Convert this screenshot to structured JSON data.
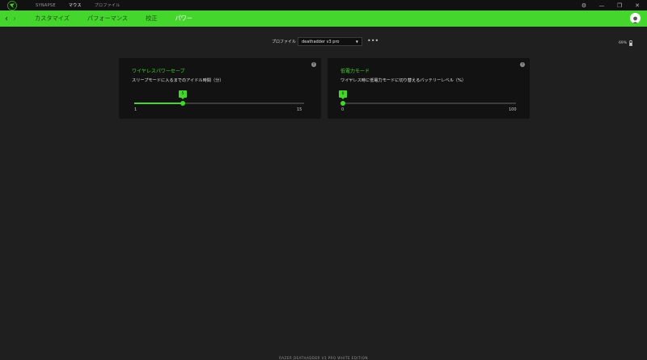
{
  "titlebar": {
    "nav": [
      {
        "label": "SYNAPSE",
        "active": false
      },
      {
        "label": "マウス",
        "active": true
      },
      {
        "label": "プロファイル",
        "active": false
      }
    ],
    "controls": {
      "settings": "⚙",
      "minimize": "—",
      "restore": "❐",
      "close": "✕"
    }
  },
  "nav": {
    "tabs": [
      {
        "label": "カスタマイズ",
        "active": false
      },
      {
        "label": "パフォーマンス",
        "active": false
      },
      {
        "label": "校正",
        "active": false
      },
      {
        "label": "パワー",
        "active": true
      }
    ]
  },
  "profile": {
    "label": "プロファイル",
    "selected": "deathadder v3 pro",
    "more": "•••"
  },
  "battery": {
    "percent": "69%"
  },
  "cards": {
    "wireless": {
      "title": "ワイヤレスパワーセーブ",
      "description": "スリープモードに入るまでのアイドル時間（分）",
      "value": "5",
      "min": "1",
      "max": "15",
      "fraction": 0.2857
    },
    "lowpower": {
      "title": "低電力モード",
      "description": "ワイヤレス時に低電力モードに切り替えるバッテリーレベル（%）",
      "value": "0",
      "min": "0",
      "max": "100",
      "fraction": 0.0
    }
  },
  "footer": {
    "device": "RAZER DEATHADDER V3 PRO WHITE EDITION"
  },
  "colors": {
    "accent": "#44d62c",
    "background": "#1f1f1f",
    "card": "#121212"
  }
}
